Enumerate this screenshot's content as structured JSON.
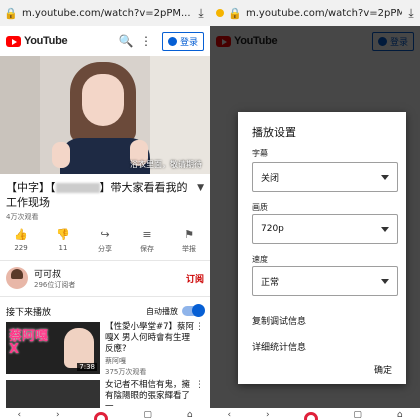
{
  "browser": {
    "url": "m.youtube.com/watch?v=2pPM...",
    "lock_icon": "lock-icon",
    "download_icon": "download-icon"
  },
  "header": {
    "logo_text": "YouTube",
    "signin_label": "登录"
  },
  "video": {
    "subtitle_text": "浴衣里面，敬请期待"
  },
  "title": {
    "prefix": "【中字】【",
    "suffix": "】带大家看看我的工作现场",
    "views": "4万次观看"
  },
  "actions": [
    {
      "icon": "like-icon",
      "glyph": "👍",
      "label": "229"
    },
    {
      "icon": "dislike-icon",
      "glyph": "👎",
      "label": "11"
    },
    {
      "icon": "share-icon",
      "glyph": "↪",
      "label": "分享"
    },
    {
      "icon": "save-icon",
      "glyph": "≡",
      "label": "保存"
    },
    {
      "icon": "report-icon",
      "glyph": "⚑",
      "label": "举报"
    }
  ],
  "channel": {
    "name": "可可叔",
    "subs": "296位订阅者",
    "subscribe_label": "订阅"
  },
  "upnext": {
    "label": "接下来播放",
    "autoplay_label": "自动播放"
  },
  "recommendations": [
    {
      "thumb_line1": "蔡阿嘎",
      "thumb_line2": "X",
      "duration": "7:38",
      "title": "【性愛小學堂#7】蔡阿嘎X 男人何時會有生理反應?",
      "channel": "蔡阿嘎",
      "views": "375万次观看"
    },
    {
      "thumb_line1": "",
      "thumb_line2": "",
      "duration": "",
      "title": "女记者不相信有鬼，擁有陰陽眼的張家輝看了一",
      "channel": "",
      "views": ""
    }
  ],
  "dialog": {
    "title": "播放设置",
    "caption_label": "字幕",
    "caption_value": "关闭",
    "quality_label": "画质",
    "quality_value": "720p",
    "speed_label": "速度",
    "speed_value": "正常",
    "copy_debug": "复制调试信息",
    "stats": "详细统计信息",
    "ok_label": "确定"
  },
  "colors": {
    "accent": "#065fd4",
    "brand_red": "#ff0000",
    "subscribe": "#cc0000"
  }
}
